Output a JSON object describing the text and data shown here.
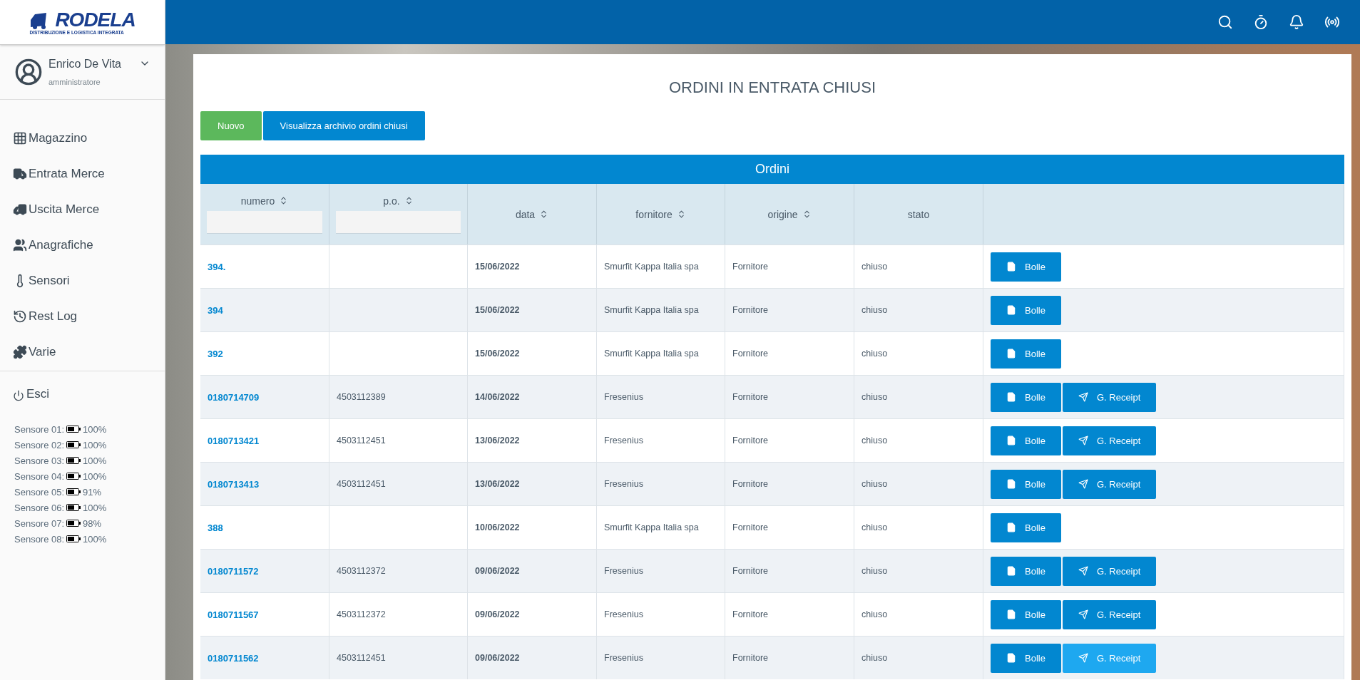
{
  "logo": {
    "name": "RODELA",
    "tagline": "DISTRIBUZIONE E LOGISTICA INTEGRATA"
  },
  "user": {
    "name": "Enrico De Vita",
    "role": "amministratore"
  },
  "menu": [
    {
      "label": "Magazzino"
    },
    {
      "label": "Entrata Merce"
    },
    {
      "label": "Uscita Merce"
    },
    {
      "label": "Anagrafiche"
    },
    {
      "label": "Sensori"
    },
    {
      "label": "Rest Log"
    },
    {
      "label": "Varie"
    }
  ],
  "logout": {
    "label": "Esci"
  },
  "sensors": [
    {
      "label": "Sensore 01:",
      "reading": "100%"
    },
    {
      "label": "Sensore 02:",
      "reading": "100%"
    },
    {
      "label": "Sensore 03:",
      "reading": "100%"
    },
    {
      "label": "Sensore 04:",
      "reading": "100%"
    },
    {
      "label": "Sensore 05:",
      "reading": "91%"
    },
    {
      "label": "Sensore 06:",
      "reading": "100%"
    },
    {
      "label": "Sensore 07:",
      "reading": "98%"
    },
    {
      "label": "Sensore 08:",
      "reading": "100%"
    }
  ],
  "page_title": "ORDINI IN ENTRATA CHIUSI",
  "actions": [
    {
      "label": "Nuovo",
      "kind": "success"
    },
    {
      "label": "Visualizza archivio ordini chiusi",
      "kind": "primary"
    }
  ],
  "table": {
    "title": "Ordini",
    "columns": [
      {
        "label": "numero",
        "sortable": true,
        "filter": true
      },
      {
        "label": "p.o.",
        "sortable": true,
        "filter": true
      },
      {
        "label": "data",
        "sortable": true,
        "filter": false
      },
      {
        "label": "fornitore",
        "sortable": true,
        "filter": false
      },
      {
        "label": "origine",
        "sortable": true,
        "filter": false
      },
      {
        "label": "stato",
        "sortable": false,
        "filter": false
      }
    ],
    "rows": [
      {
        "numero": "394.",
        "po": "",
        "data": "15/06/2022",
        "fornitore": "Smurfit Kappa Italia spa",
        "origine": "Fornitore",
        "stato": "chiuso",
        "buttons": [
          {
            "label": "Bolle",
            "kind": "file",
            "hovered": false
          }
        ]
      },
      {
        "numero": "394",
        "po": "",
        "data": "15/06/2022",
        "fornitore": "Smurfit Kappa Italia spa",
        "origine": "Fornitore",
        "stato": "chiuso",
        "buttons": [
          {
            "label": "Bolle",
            "kind": "file",
            "hovered": false
          }
        ]
      },
      {
        "numero": "392",
        "po": "",
        "data": "15/06/2022",
        "fornitore": "Smurfit Kappa Italia spa",
        "origine": "Fornitore",
        "stato": "chiuso",
        "buttons": [
          {
            "label": "Bolle",
            "kind": "file",
            "hovered": false
          }
        ]
      },
      {
        "numero": "0180714709",
        "po": "4503112389",
        "data": "14/06/2022",
        "fornitore": "Fresenius",
        "origine": "Fornitore",
        "stato": "chiuso",
        "buttons": [
          {
            "label": "Bolle",
            "kind": "file",
            "hovered": false
          },
          {
            "label": "G. Receipt",
            "kind": "send",
            "hovered": false
          }
        ]
      },
      {
        "numero": "0180713421",
        "po": "4503112451",
        "data": "13/06/2022",
        "fornitore": "Fresenius",
        "origine": "Fornitore",
        "stato": "chiuso",
        "buttons": [
          {
            "label": "Bolle",
            "kind": "file",
            "hovered": false
          },
          {
            "label": "G. Receipt",
            "kind": "send",
            "hovered": false
          }
        ]
      },
      {
        "numero": "0180713413",
        "po": "4503112451",
        "data": "13/06/2022",
        "fornitore": "Fresenius",
        "origine": "Fornitore",
        "stato": "chiuso",
        "buttons": [
          {
            "label": "Bolle",
            "kind": "file",
            "hovered": false
          },
          {
            "label": "G. Receipt",
            "kind": "send",
            "hovered": false
          }
        ]
      },
      {
        "numero": "388",
        "po": "",
        "data": "10/06/2022",
        "fornitore": "Smurfit Kappa Italia spa",
        "origine": "Fornitore",
        "stato": "chiuso",
        "buttons": [
          {
            "label": "Bolle",
            "kind": "file",
            "hovered": false
          }
        ]
      },
      {
        "numero": "0180711572",
        "po": "4503112372",
        "data": "09/06/2022",
        "fornitore": "Fresenius",
        "origine": "Fornitore",
        "stato": "chiuso",
        "buttons": [
          {
            "label": "Bolle",
            "kind": "file",
            "hovered": false
          },
          {
            "label": "G. Receipt",
            "kind": "send",
            "hovered": false
          }
        ]
      },
      {
        "numero": "0180711567",
        "po": "4503112372",
        "data": "09/06/2022",
        "fornitore": "Fresenius",
        "origine": "Fornitore",
        "stato": "chiuso",
        "buttons": [
          {
            "label": "Bolle",
            "kind": "file",
            "hovered": false
          },
          {
            "label": "G. Receipt",
            "kind": "send",
            "hovered": false
          }
        ]
      },
      {
        "numero": "0180711562",
        "po": "4503112451",
        "data": "09/06/2022",
        "fornitore": "Fresenius",
        "origine": "Fornitore",
        "stato": "chiuso",
        "buttons": [
          {
            "label": "Bolle",
            "kind": "file",
            "hovered": false
          },
          {
            "label": "G. Receipt",
            "kind": "send",
            "hovered": true
          }
        ]
      }
    ]
  }
}
